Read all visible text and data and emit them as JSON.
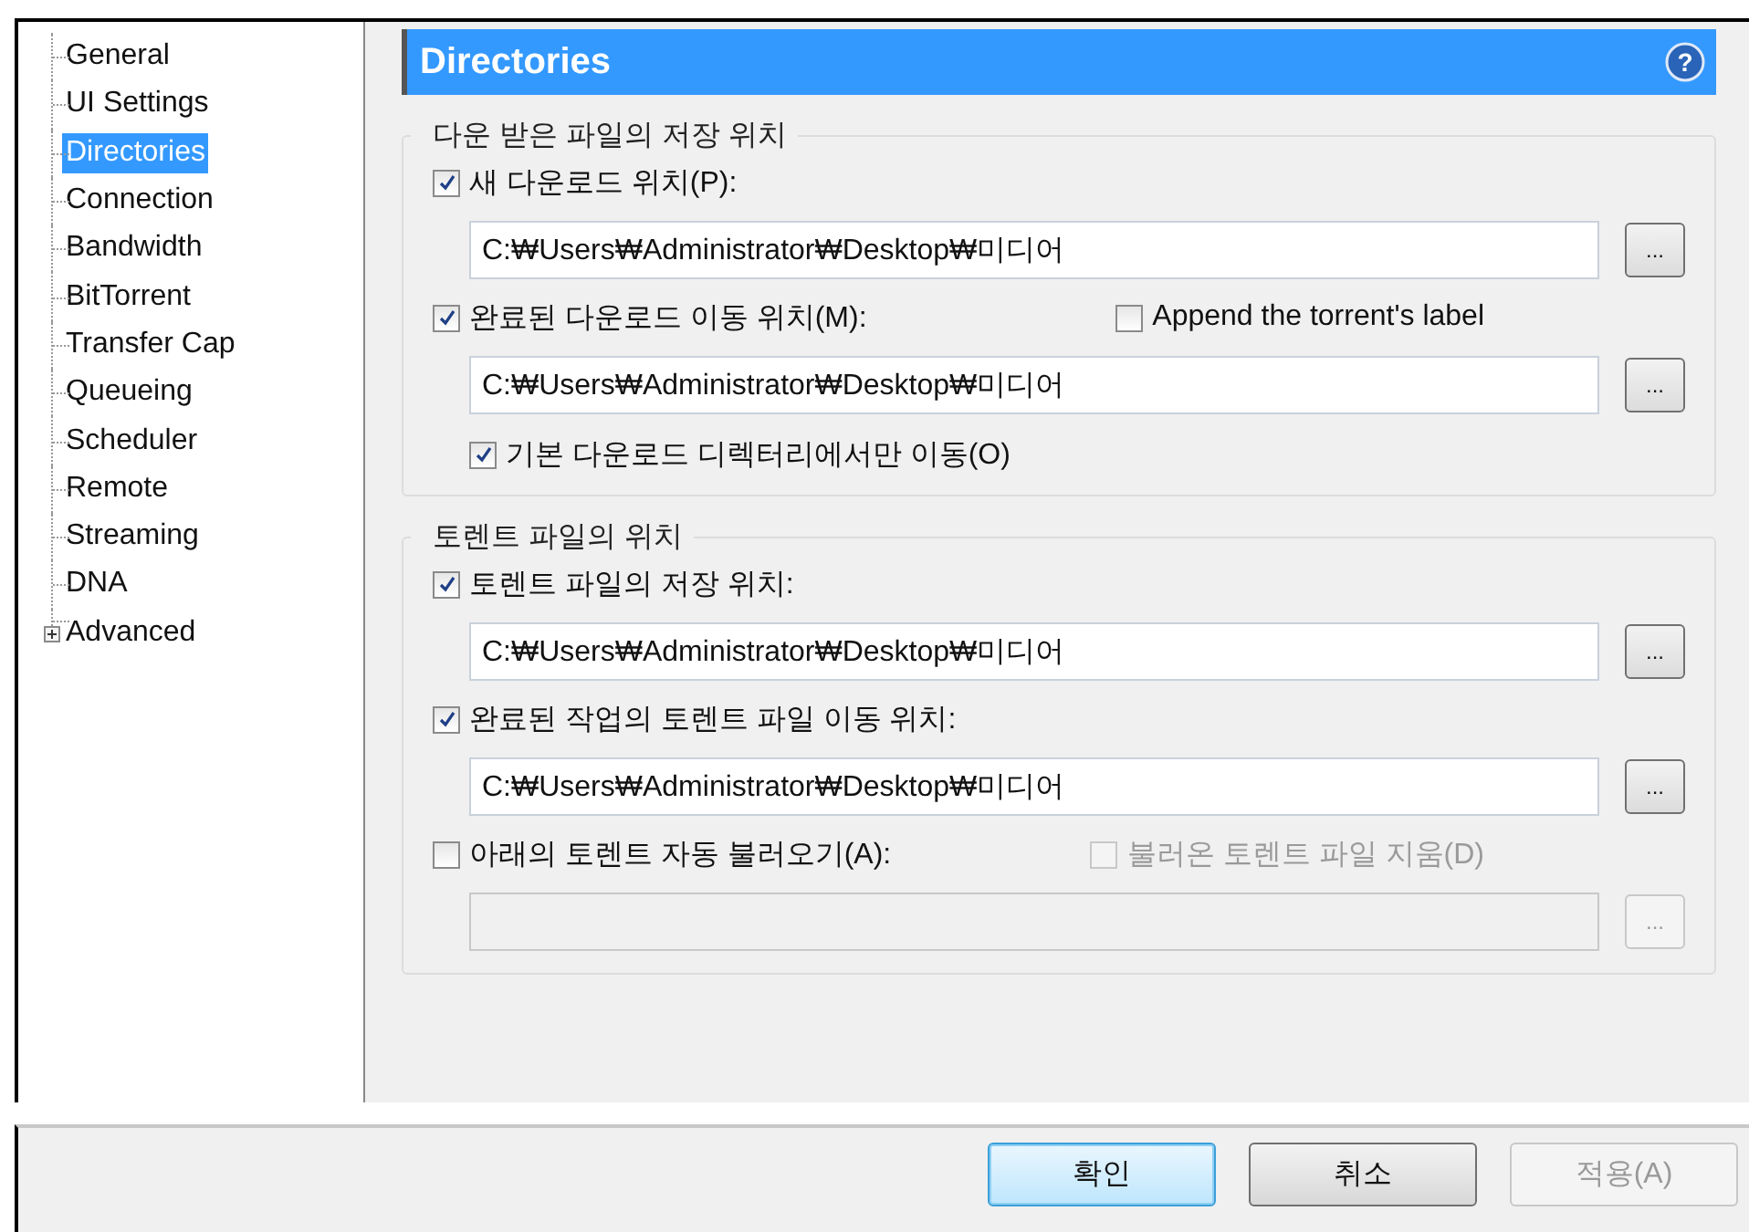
{
  "sidebar": {
    "items": [
      {
        "label": "General",
        "selected": false,
        "expandable": false
      },
      {
        "label": "UI Settings",
        "selected": false,
        "expandable": false
      },
      {
        "label": "Directories",
        "selected": true,
        "expandable": false
      },
      {
        "label": "Connection",
        "selected": false,
        "expandable": false
      },
      {
        "label": "Bandwidth",
        "selected": false,
        "expandable": false
      },
      {
        "label": "BitTorrent",
        "selected": false,
        "expandable": false
      },
      {
        "label": "Transfer Cap",
        "selected": false,
        "expandable": false
      },
      {
        "label": "Queueing",
        "selected": false,
        "expandable": false
      },
      {
        "label": "Scheduler",
        "selected": false,
        "expandable": false
      },
      {
        "label": "Remote",
        "selected": false,
        "expandable": false
      },
      {
        "label": "Streaming",
        "selected": false,
        "expandable": false
      },
      {
        "label": "DNA",
        "selected": false,
        "expandable": false
      },
      {
        "label": "Advanced",
        "selected": false,
        "expandable": true
      }
    ]
  },
  "header": {
    "title": "Directories",
    "help": "?"
  },
  "groups": [
    {
      "title": "다운 받은 파일의 저장 위치",
      "rows": [
        {
          "kind": "check",
          "label": "새 다운로드 위치(P):",
          "checked": true,
          "disabled": false
        },
        {
          "kind": "path",
          "value": "C:₩Users₩Administrator₩Desktop₩미디어",
          "browse": "...",
          "disabled": false
        },
        {
          "kind": "check",
          "label": "완료된 다운로드 이동 위치(M):",
          "checked": true,
          "disabled": false,
          "extra": {
            "label": "Append the torrent's label",
            "checked": false,
            "disabled": false
          }
        },
        {
          "kind": "path",
          "value": "C:₩Users₩Administrator₩Desktop₩미디어",
          "browse": "...",
          "disabled": false
        },
        {
          "kind": "subcheck",
          "label": "기본 다운로드 디렉터리에서만 이동(O)",
          "checked": true,
          "disabled": false
        }
      ]
    },
    {
      "title": "토렌트 파일의 위치",
      "rows": [
        {
          "kind": "check",
          "label": "토렌트 파일의 저장 위치:",
          "checked": true,
          "disabled": false
        },
        {
          "kind": "path",
          "value": "C:₩Users₩Administrator₩Desktop₩미디어",
          "browse": "...",
          "disabled": false
        },
        {
          "kind": "check",
          "label": "완료된 작업의 토렌트 파일 이동 위치:",
          "checked": true,
          "disabled": false
        },
        {
          "kind": "path",
          "value": "C:₩Users₩Administrator₩Desktop₩미디어",
          "browse": "...",
          "disabled": false
        },
        {
          "kind": "check",
          "label": "아래의 토렌트 자동 불러오기(A):",
          "checked": false,
          "disabled": false,
          "extra": {
            "label": "불러온 토렌트 파일 지움(D)",
            "checked": false,
            "disabled": true
          }
        },
        {
          "kind": "path",
          "browse": "...",
          "disabled": true
        }
      ]
    }
  ],
  "buttons": [
    {
      "label": "확인",
      "default": true,
      "disabled": false
    },
    {
      "label": "취소",
      "default": false,
      "disabled": false
    },
    {
      "label": "적용(A)",
      "default": false,
      "disabled": true
    }
  ]
}
